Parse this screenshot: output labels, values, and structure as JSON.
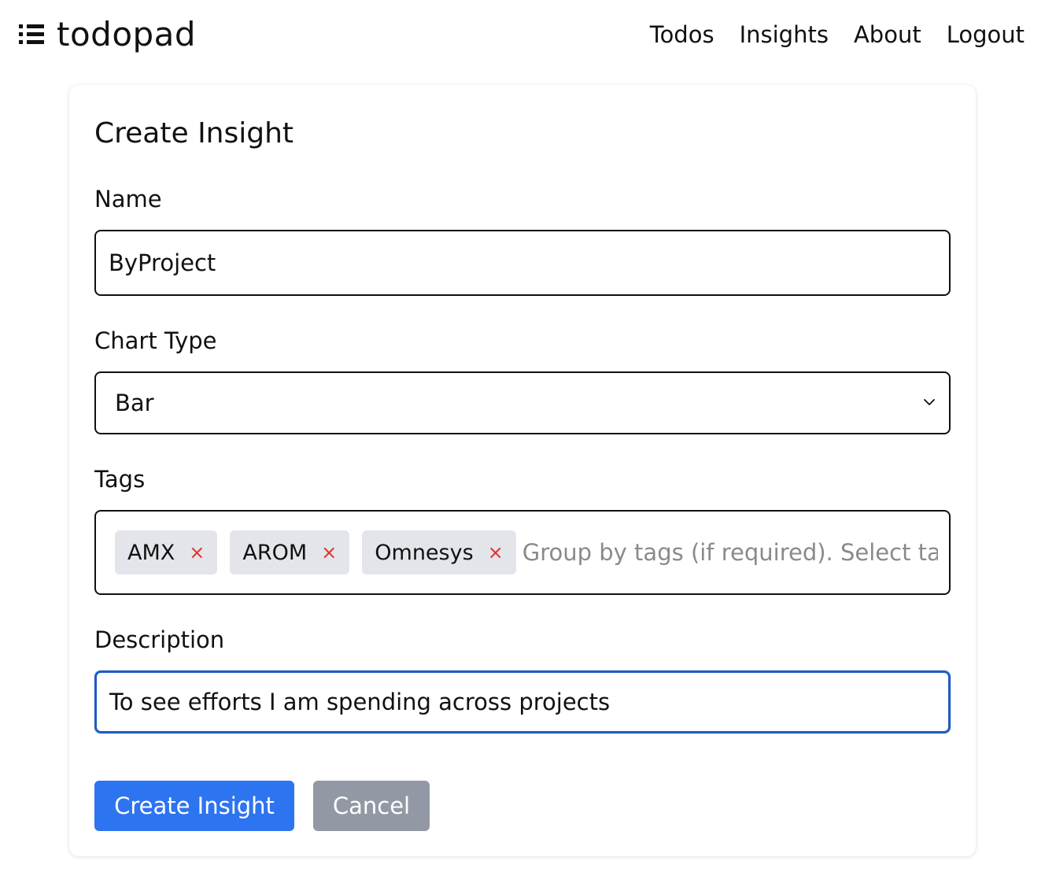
{
  "app": {
    "brand": "todopad",
    "brand_icon": "list-icon"
  },
  "nav": {
    "items": [
      "Todos",
      "Insights",
      "About",
      "Logout"
    ]
  },
  "form": {
    "title": "Create Insight",
    "name": {
      "label": "Name",
      "value": "ByProject"
    },
    "chart_type": {
      "label": "Chart Type",
      "selected": "Bar",
      "icon": "chevron-down-icon"
    },
    "tags": {
      "label": "Tags",
      "selected": [
        "AMX",
        "AROM",
        "Omnesys"
      ],
      "remove_glyph": "×",
      "placeholder": "Group by tags (if required). Select tag a"
    },
    "description": {
      "label": "Description",
      "value": "To see efforts I am spending across projects"
    },
    "buttons": {
      "submit": "Create Insight",
      "cancel": "Cancel"
    }
  },
  "colors": {
    "primary": "#2d74f0",
    "secondary": "#9298a4",
    "focus_border": "#1f5cc4",
    "tag_bg": "#e3e5ea",
    "tag_remove": "#e03131"
  }
}
